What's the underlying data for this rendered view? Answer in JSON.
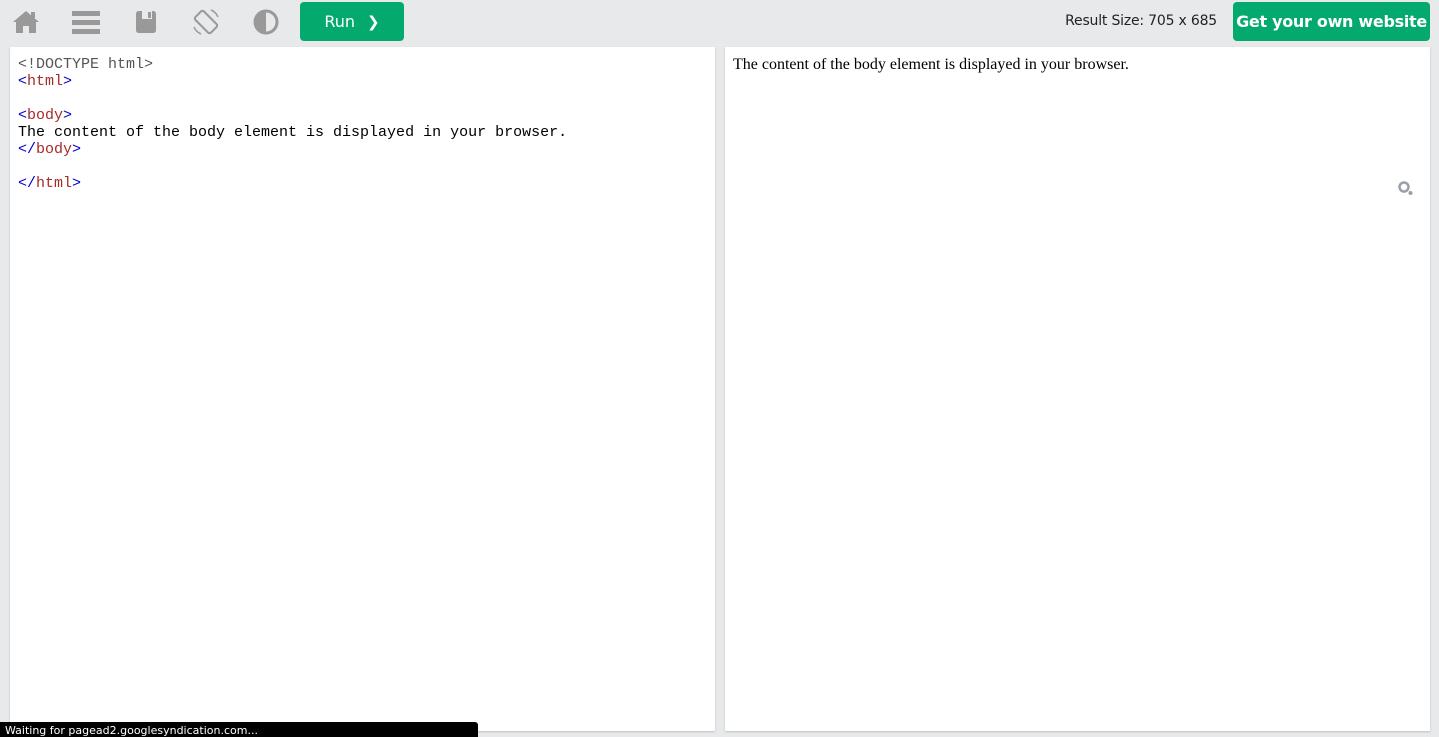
{
  "toolbar": {
    "icons": [
      "home-icon",
      "menu-icon",
      "save-icon",
      "rotate-icon",
      "contrast-icon"
    ],
    "run_label": "Run",
    "run_chevron": "❯",
    "result_size_label": "Result Size: 705 x 685",
    "get_website_label": "Get your own website",
    "accent_color": "#04aa6d"
  },
  "editor": {
    "lines": [
      {
        "type": "doctype",
        "text": "<!DOCTYPE html>"
      },
      {
        "type": "tag",
        "open": "<",
        "name": "html",
        "close": ">"
      },
      {
        "type": "blank"
      },
      {
        "type": "tag",
        "open": "<",
        "name": "body",
        "close": ">"
      },
      {
        "type": "text",
        "text": "The content of the body element is displayed in your browser."
      },
      {
        "type": "tag",
        "open": "</",
        "name": "body",
        "close": ">"
      },
      {
        "type": "blank"
      },
      {
        "type": "tag",
        "open": "</",
        "name": "html",
        "close": ">"
      }
    ]
  },
  "result": {
    "text": "The content of the body element is displayed in your browser."
  },
  "status": {
    "text": "Waiting for pagead2.googlesyndication.com..."
  }
}
